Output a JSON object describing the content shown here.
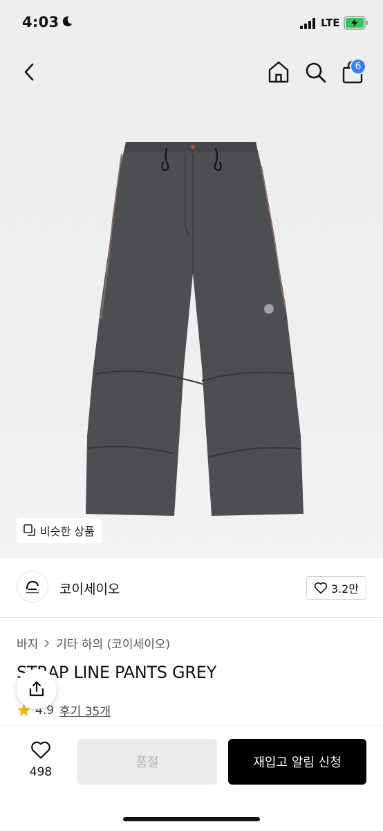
{
  "status_bar": {
    "time": "4:03",
    "network": "LTE"
  },
  "nav": {
    "cart_count": "6"
  },
  "product_image": {
    "similar_label": "비슷한 상품"
  },
  "brand": {
    "name": "코이세이오",
    "likes": "3.2만"
  },
  "breadcrumb": {
    "category": "바지",
    "subcategory": "기타 하의 (코이세이오)"
  },
  "product": {
    "title": "STRAP LINE PANTS GREY",
    "rating": "4.9",
    "reviews": "후기 35개"
  },
  "bottom_bar": {
    "wish_count": "498",
    "soldout_label": "품절",
    "restock_label": "재입고 알림 신청"
  },
  "colors": {
    "accent": "#3b7cf0",
    "star": "#f5b400",
    "primary_button": "#000000"
  }
}
